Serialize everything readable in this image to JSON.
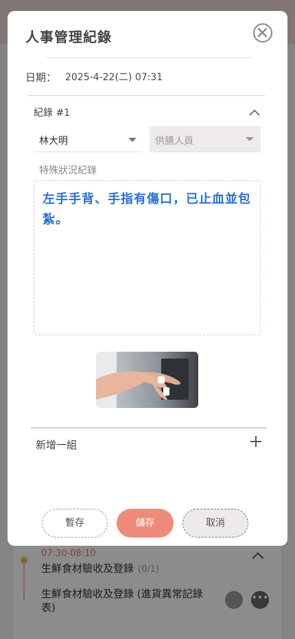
{
  "modal": {
    "title": "人事管理紀錄",
    "date_label": "日期：",
    "date_value": "2025-4-22(二) 07:31",
    "record": {
      "title": "紀錄 #1",
      "person_selected": "林大明",
      "staff_placeholder": "供膳人員",
      "notes_label": "特殊狀況紀錄",
      "notes_text": "左手手背、手指有傷口，已止血並包紮。"
    },
    "add_group_label": "新增一組",
    "buttons": {
      "draft": "暫存",
      "save": "儲存",
      "cancel": "取消"
    }
  },
  "background": {
    "time": "07:30-08:10",
    "task1_title": "生鮮食材驗收及登錄",
    "task1_count": "(0/1)",
    "task2_title": "生鮮食材驗收及登錄 (進貨異常記錄表)"
  },
  "colors": {
    "accent": "#ee8b7b",
    "notes_text": "#2a6fd6",
    "overlay": "rgba(0,0,0,0.45)"
  },
  "icons": {
    "close": "close-circle-icon",
    "collapse": "chevron-up-icon",
    "add": "plus-icon",
    "dropdown": "caret-down-icon"
  }
}
